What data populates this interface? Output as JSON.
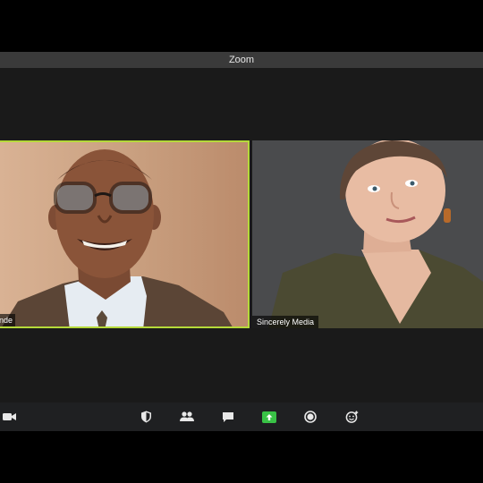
{
  "window": {
    "title": "Zoom"
  },
  "participants": [
    {
      "name": "nde",
      "active_speaker": true
    },
    {
      "name": "Sincerely Media",
      "active_speaker": false
    }
  ],
  "toolbar": {
    "buttons": [
      {
        "id": "video",
        "icon": "video-camera-icon"
      },
      {
        "id": "security",
        "icon": "shield-icon"
      },
      {
        "id": "participants",
        "icon": "participants-icon"
      },
      {
        "id": "chat",
        "icon": "chat-bubble-icon"
      },
      {
        "id": "share-screen",
        "icon": "share-screen-icon"
      },
      {
        "id": "record",
        "icon": "record-icon"
      },
      {
        "id": "reactions",
        "icon": "reactions-icon"
      }
    ]
  },
  "colors": {
    "active_speaker_border": "#b5d93a",
    "share_screen_green": "#39c246",
    "toolbar_bg": "#1f2022",
    "titlebar_bg": "#3a3a3a"
  }
}
